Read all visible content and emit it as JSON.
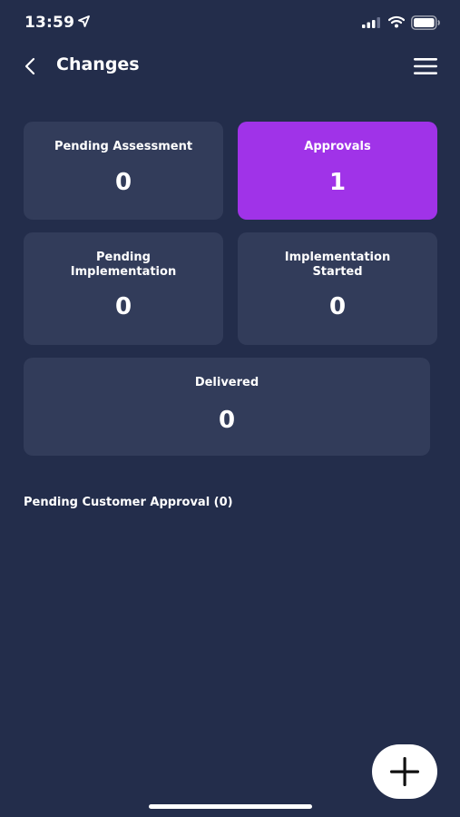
{
  "status_bar": {
    "time": "13:59"
  },
  "header": {
    "title": "Changes"
  },
  "cards": [
    {
      "label": "Pending Assessment",
      "count": "0"
    },
    {
      "label": "Approvals",
      "count": "1"
    },
    {
      "label": "Pending\nImplementation",
      "count": "0"
    },
    {
      "label": "Implementation\nStarted",
      "count": "0"
    },
    {
      "label": "Delivered",
      "count": "0"
    }
  ],
  "section": {
    "title": "Pending Customer Approval (0)"
  },
  "colors": {
    "background": "#232d4b",
    "card": "#323c5a",
    "active_card": "#a033e8",
    "fab": "#ffffff"
  },
  "icons": [
    "location-arrow-icon",
    "signal-icon",
    "wifi-icon",
    "battery-icon",
    "back-chevron-icon",
    "hamburger-menu-icon",
    "plus-icon"
  ]
}
